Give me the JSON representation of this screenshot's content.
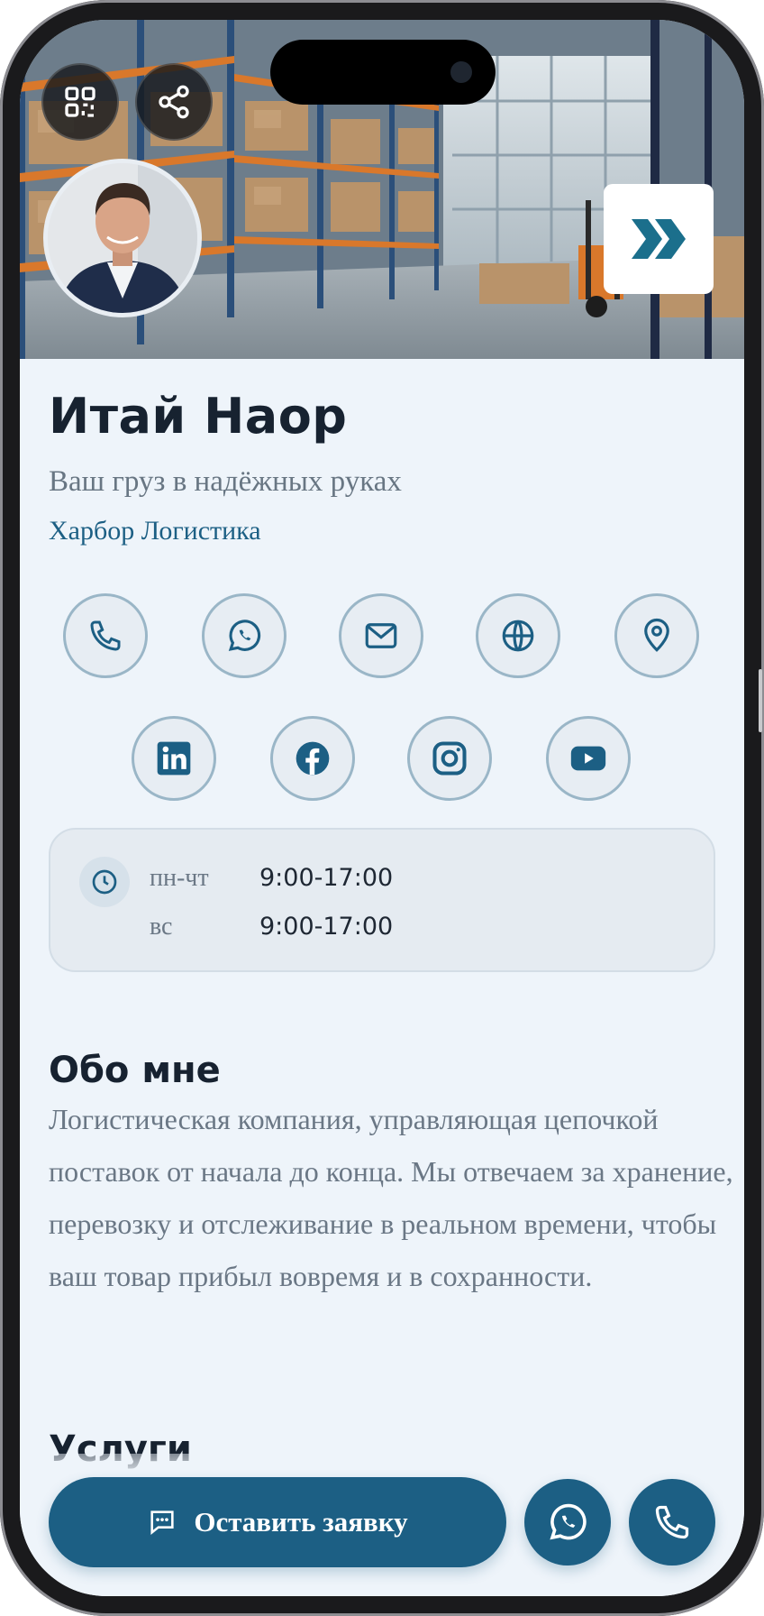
{
  "profile": {
    "name": "Итай Наор",
    "tagline": "Ваш груз в надёжных руках",
    "company": "Харбор Логистика"
  },
  "contact_icons": [
    "phone-icon",
    "whatsapp-icon",
    "email-icon",
    "globe-icon",
    "location-pin-icon"
  ],
  "social_icons": [
    "linkedin-icon",
    "facebook-icon",
    "instagram-icon",
    "youtube-icon"
  ],
  "hours": [
    {
      "day": "пн-чт",
      "time": "9:00-17:00"
    },
    {
      "day": "вс",
      "time": "9:00-17:00"
    }
  ],
  "about": {
    "title": "Обо мне",
    "text": "Логистическая компания, управляющая цепочкой поставок от начала до конца. Мы отвечаем за хранение, перевозку и отслеживание в реальном времени, чтобы ваш товар прибыл вовремя и в сохранности."
  },
  "services": {
    "title": "Услуги"
  },
  "bottom_bar": {
    "cta_label": "Оставить заявку"
  },
  "colors": {
    "accent": "#1c5f84",
    "background": "#eef4fa",
    "icon_border": "#9ab6c7",
    "heading": "#172230",
    "muted_text": "#6a7785"
  }
}
